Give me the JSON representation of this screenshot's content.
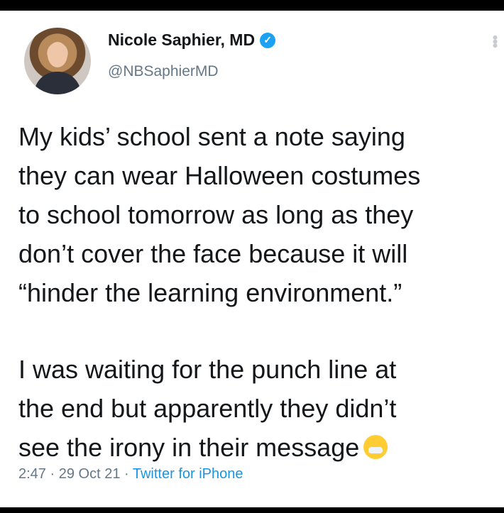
{
  "tweet": {
    "name": "Nicole Saphier, MD",
    "handle": "@NBSaphierMD",
    "text_para1": "My kids’ school sent a note saying\nthey can wear Halloween costumes\nto school tomorrow as long as they\ndon’t cover the face because it will\n“hinder the learning environment.”",
    "text_para2": "I was waiting for the punch line at\nthe end but apparently they didn’t\nsee the irony in their message",
    "time": "2:47",
    "date": "29 Oct 21",
    "client": "Twitter for iPhone",
    "separator": " · "
  },
  "icons": {
    "verified": "verified-badge-icon",
    "emoji": "grinning-face-with-medical-mask-icon",
    "more": "more-options-icon"
  },
  "colors": {
    "link": "#1b95e0",
    "verified": "#1da1f2",
    "text": "#14171a",
    "muted": "#657786"
  }
}
